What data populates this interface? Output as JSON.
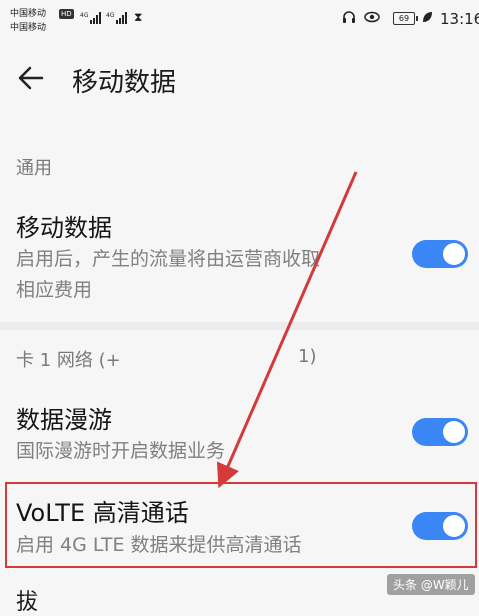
{
  "status_bar": {
    "carrier_1": "中国移动",
    "carrier_1_badge": "HD",
    "carrier_2": "中国移动",
    "signal_1_tag": "4G",
    "signal_2_tag": "4G",
    "battery": "69",
    "time": "13:16",
    "icons": [
      "hourglass-icon",
      "headset-icon",
      "eye-icon",
      "battery-icon",
      "leaf-icon"
    ]
  },
  "header": {
    "title": "移动数据",
    "back_icon": "back-arrow-icon"
  },
  "sections": {
    "general_label": "通用",
    "card1_label_left": "卡 1 网络 (+",
    "card1_label_right": "1)"
  },
  "items": {
    "mobile_data": {
      "title": "移动数据",
      "desc_line1": "启用后，产生的流量将由运营商收取",
      "desc_line2": "相应费用",
      "enabled": true
    },
    "roaming": {
      "title": "数据漫游",
      "desc": "国际漫游时开启数据业务",
      "enabled": true
    },
    "volte": {
      "title": "VoLTE 高清通话",
      "desc": "启用 4G LTE 数据来提供高清通话",
      "enabled": true
    },
    "next_cut": "拔"
  },
  "annotation": {
    "highlight_color": "#d33a3a",
    "arrow_color": "#d33a3a"
  },
  "watermark": "头条 @W颖儿",
  "colors": {
    "toggle_on": "#3a86f5"
  }
}
